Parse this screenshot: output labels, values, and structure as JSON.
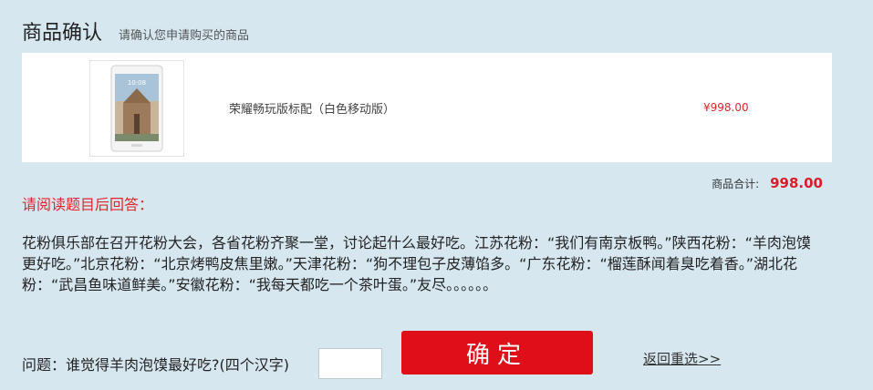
{
  "header": {
    "title": "商品确认",
    "subtitle": "请确认您申请购买的商品"
  },
  "product": {
    "name": "荣耀畅玩版标配（白色移动版）",
    "price": "¥998.00",
    "screen_time": "10:08"
  },
  "summary": {
    "label": "商品合计:",
    "value": "998.00"
  },
  "notice": "请阅读题目后回答：",
  "story": "花粉俱乐部在召开花粉大会，各省花粉齐聚一堂，讨论起什么最好吃。江苏花粉：“我们有南京板鸭。”陕西花粉：“羊肉泡馍更好吃。”北京花粉：“北京烤鸭皮焦里嫩。”天津花粉：“狗不理包子皮薄馅多。“广东花粉：“榴莲酥闻着臭吃着香。”湖北花粉：“武昌鱼味道鲜美。”安徽花粉：“我每天都吃一个茶叶蛋。”友尽。。。。。。",
  "form": {
    "question": "问题：谁觉得羊肉泡馍最好吃?(四个汉字)",
    "answer_value": "",
    "confirm_label": "确定",
    "back_label": "返回重选>>"
  },
  "colors": {
    "background": "#d7e7f0",
    "accent_red": "#df0f19",
    "price_red": "#e0252a"
  }
}
